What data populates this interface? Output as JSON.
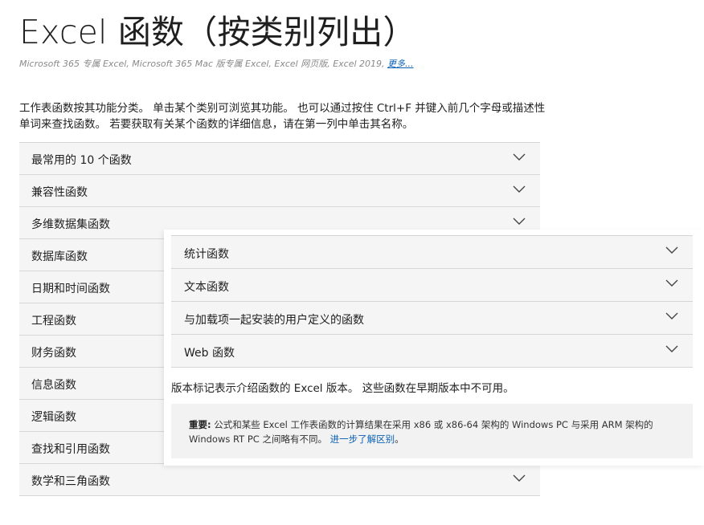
{
  "header": {
    "title": "Excel 函数（按类别列出）",
    "applies_to": "Microsoft 365 专属 Excel, Microsoft 365 Mac 版专属 Excel, Excel 网页版, Excel 2019, ",
    "more_link": "更多..."
  },
  "intro": {
    "line1": "工作表函数按其功能分类。 单击某个类别可浏览其功能。 也可以通过按住 Ctrl+F 并键入前几个字母或描述性",
    "line2": "单词来查找函数。 若要获取有关某个函数的详细信息，请在第一列中单击其名称。"
  },
  "categories": [
    {
      "label": "最常用的 10 个函数"
    },
    {
      "label": "兼容性函数"
    },
    {
      "label": "多维数据集函数"
    },
    {
      "label": "数据库函数"
    },
    {
      "label": "日期和时间函数"
    },
    {
      "label": "工程函数"
    },
    {
      "label": "财务函数"
    },
    {
      "label": "信息函数"
    },
    {
      "label": "逻辑函数"
    },
    {
      "label": "查找和引用函数"
    },
    {
      "label": "数学和三角函数"
    }
  ],
  "overlay": {
    "categories": [
      {
        "label": "统计函数"
      },
      {
        "label": "文本函数"
      },
      {
        "label": "与加载项一起安装的用户定义的函数"
      },
      {
        "label": "Web 函数"
      }
    ],
    "version_note": "版本标记表示介绍函数的 Excel 版本。 这些函数在早期版本中不可用。",
    "callout": {
      "bold": "重要:",
      "text1": " 公式和某些 Excel 工作表函数的计算结果在采用 x86 或 x86-64 架构的 Windows PC 与采用 ARM 架构的",
      "text2": "Windows RT PC 之间略有不同。 ",
      "link": "进一步了解区别",
      "end": "。"
    }
  },
  "colors": {
    "link": "#0a61b5",
    "row_bg": "#f5f5f5",
    "callout_bg": "#f2f2f2"
  },
  "icons": {
    "expand": "chevron-down-icon"
  }
}
